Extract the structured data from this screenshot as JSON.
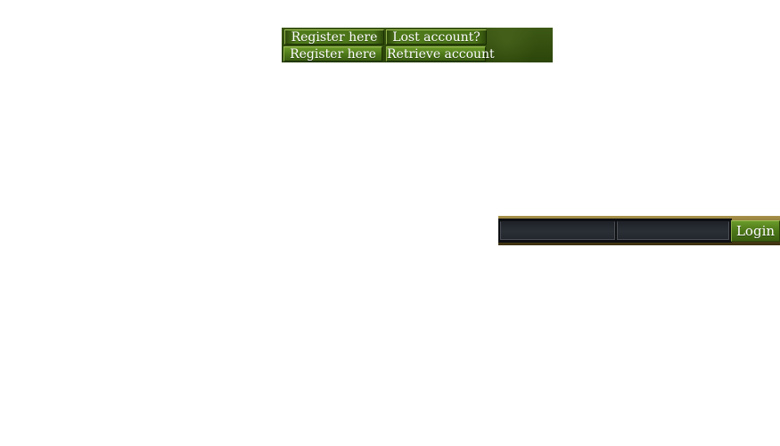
{
  "nav": {
    "row1": {
      "register_label": "Register here",
      "lost_label": "Lost account?"
    },
    "row2": {
      "register_label": "Register here",
      "retrieve_label": "Retrieve account"
    }
  },
  "login": {
    "username_value": "",
    "password_value": "",
    "button_label": "Login"
  },
  "colors": {
    "accent_green": "#4a7318",
    "gold_frame": "#a8914a",
    "field_dark": "#1f2329"
  }
}
